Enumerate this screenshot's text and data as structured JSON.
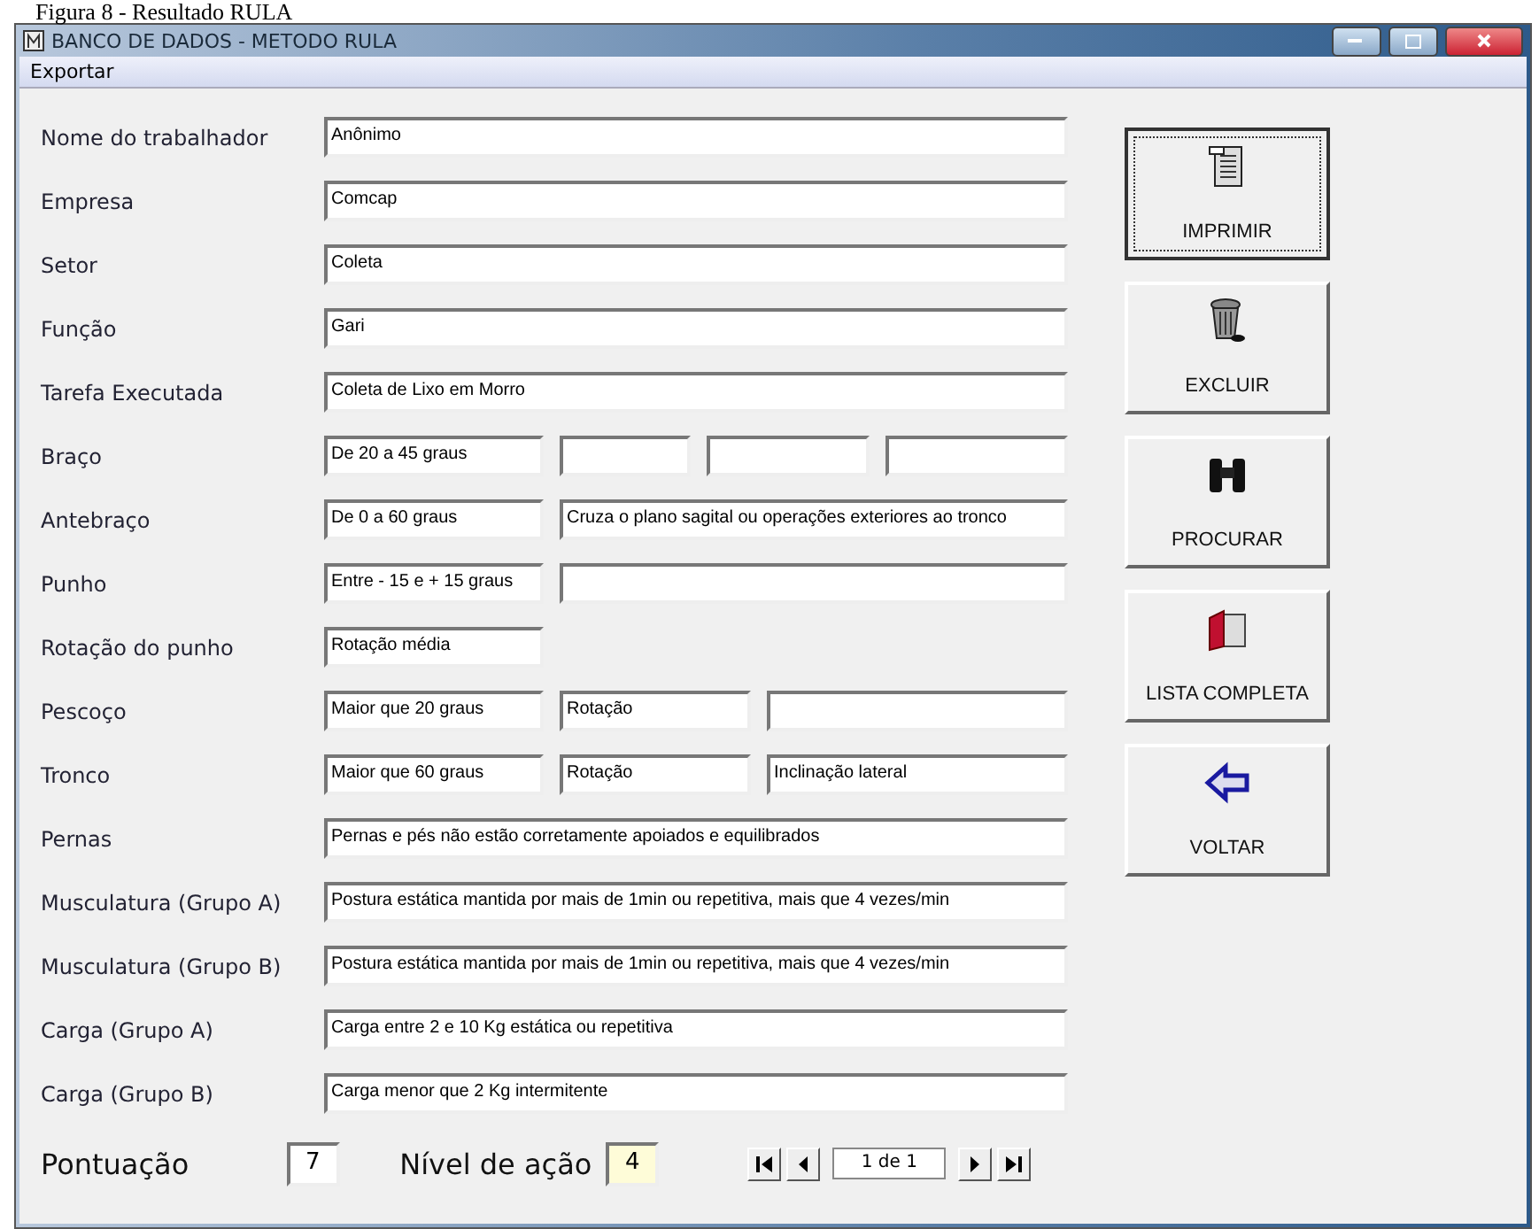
{
  "caption": "Figura 8 - Resultado RULA",
  "window": {
    "title": "BANCO DE DADOS - METODO RULA"
  },
  "menu": [
    "Exportar"
  ],
  "rows": [
    {
      "label": "Nome do trabalhador",
      "kind": "full",
      "values": [
        "Anônimo"
      ]
    },
    {
      "label": "Empresa",
      "kind": "full",
      "values": [
        "Comcap"
      ]
    },
    {
      "label": "Setor",
      "kind": "full",
      "values": [
        "Coleta"
      ]
    },
    {
      "label": "Função",
      "kind": "full",
      "values": [
        "Gari"
      ]
    },
    {
      "label": "Tarefa Executada",
      "kind": "full",
      "values": [
        "Coleta de Lixo em Morro"
      ]
    },
    {
      "label": "Braço",
      "kind": "four",
      "values": [
        "De 20 a 45 graus"
      ]
    },
    {
      "label": "Antebraço",
      "kind": "two",
      "values": [
        "De 0 a 60 graus",
        "Cruza o plano sagital ou operações exteriores ao tronco"
      ]
    },
    {
      "label": "Punho",
      "kind": "two",
      "values": [
        "Entre - 15 e + 15 graus"
      ]
    },
    {
      "label": "Rotação do punho",
      "kind": "one",
      "values": [
        "Rotação média"
      ]
    },
    {
      "label": "Pescoço",
      "kind": "three",
      "values": [
        "Maior que 20 graus",
        "Rotação"
      ]
    },
    {
      "label": "Tronco",
      "kind": "three",
      "values": [
        "Maior que 60 graus",
        "Rotação",
        "Inclinação lateral"
      ]
    },
    {
      "label": "Pernas",
      "kind": "full",
      "values": [
        "Pernas e pés não estão corretamente apoiados e equilibrados"
      ]
    },
    {
      "label": "Musculatura (Grupo A)",
      "kind": "full",
      "values": [
        "Postura estática mantida por mais de 1min ou repetitiva, mais que 4 vezes/min"
      ]
    },
    {
      "label": "Musculatura (Grupo B)",
      "kind": "full",
      "values": [
        "Postura estática mantida por mais de 1min ou repetitiva, mais que 4 vezes/min"
      ]
    },
    {
      "label": "Carga (Grupo A)",
      "kind": "full",
      "values": [
        "Carga entre 2 e 10 Kg estática ou repetitiva"
      ]
    },
    {
      "label": "Carga (Grupo B)",
      "kind": "full",
      "values": [
        "Carga menor que 2 Kg intermitente"
      ]
    }
  ],
  "score": {
    "label": "Pontuação",
    "value": "7"
  },
  "action_level": {
    "label": "Nível de ação",
    "value": "4"
  },
  "record_nav": {
    "position": "1 de 1"
  },
  "buttons": [
    {
      "label": "IMPRIMIR",
      "kind": "print",
      "focused": true
    },
    {
      "label": "EXCLUIR",
      "kind": "delete",
      "focused": false
    },
    {
      "label": "PROCURAR",
      "kind": "search",
      "focused": false
    },
    {
      "label": "LISTA COMPLETA",
      "kind": "list",
      "focused": false
    },
    {
      "label": "VOLTAR",
      "kind": "back",
      "focused": false
    }
  ]
}
